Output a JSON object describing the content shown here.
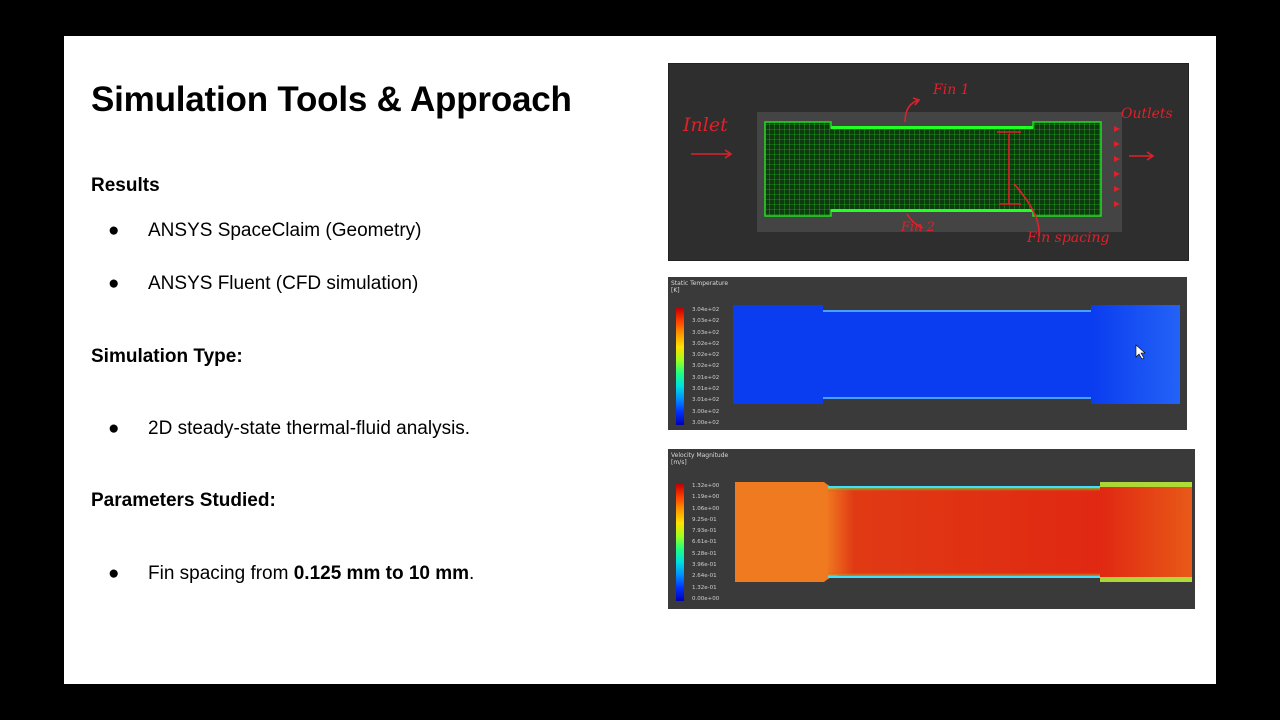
{
  "slide": {
    "title": "Simulation Tools & Approach",
    "sections": {
      "results_heading": "Results",
      "tools": [
        "ANSYS SpaceClaim (Geometry)",
        "ANSYS Fluent (CFD simulation)"
      ],
      "sim_type_heading": "Simulation Type:",
      "sim_type": "2D steady-state thermal-fluid analysis.",
      "params_heading": "Parameters Studied:",
      "params_prefix": "Fin spacing from ",
      "params_bold": "0.125 mm to 10 mm",
      "params_suffix": "."
    },
    "bullet": "●"
  },
  "mesh_image": {
    "annotations": {
      "inlet": "Inlet",
      "outlet": "Outlets",
      "fin1": "Fin 1",
      "fin2": "Fin 2",
      "spacing": "Fin spacing"
    },
    "colors": {
      "mesh": "#22dd22",
      "annotation": "#e0202a"
    }
  },
  "temperature_plot": {
    "label_line1": "Static Temperature",
    "label_line2": "[K]",
    "ticks": [
      "3.04e+02",
      "3.03e+02",
      "3.03e+02",
      "3.02e+02",
      "3.02e+02",
      "3.02e+02",
      "3.01e+02",
      "3.01e+02",
      "3.01e+02",
      "3.00e+02",
      "3.00e+02"
    ],
    "colors": {
      "field": "#0a3cf0"
    }
  },
  "velocity_plot": {
    "label_line1": "Velocity Magnitude",
    "label_line2": "[m/s]",
    "ticks": [
      "1.32e+00",
      "1.19e+00",
      "1.06e+00",
      "9.25e-01",
      "7.93e-01",
      "6.61e-01",
      "5.28e-01",
      "3.96e-01",
      "2.64e-01",
      "1.32e-01",
      "0.00e+00"
    ],
    "colors": {
      "field": "#e02812",
      "inlet": "#f07a20"
    }
  }
}
